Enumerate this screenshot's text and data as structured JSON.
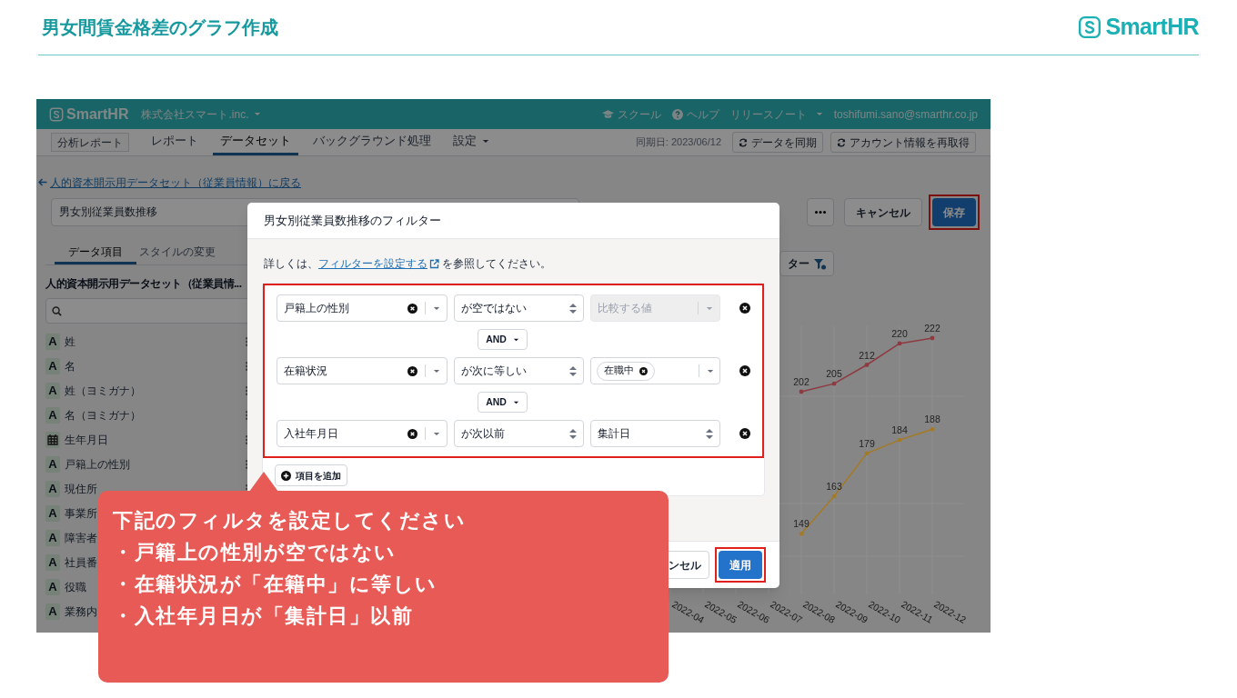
{
  "slide": {
    "title": "男女間賃金格差のグラフ作成",
    "logo": "SmartHR"
  },
  "app": {
    "header": {
      "logo": "SmartHR",
      "company": "株式会社スマート.inc.",
      "links": [
        {
          "kind": "school",
          "label": "スクール"
        },
        {
          "kind": "help",
          "label": "ヘルプ"
        },
        {
          "kind": "menu",
          "label": "リリースノート"
        }
      ],
      "user": "toshifumi.sano@smarthr.co.jp"
    },
    "nav": {
      "items": [
        {
          "label": "分析レポート",
          "kind": "button",
          "selected": false
        },
        {
          "label": "レポート",
          "kind": "tab",
          "selected": false
        },
        {
          "label": "データセット",
          "kind": "tab",
          "selected": true
        },
        {
          "label": "バックグラウンド処理",
          "kind": "tab",
          "selected": false
        },
        {
          "label": "設定",
          "kind": "menu",
          "selected": false
        }
      ],
      "sync_date": "同期日: 2023/06/12",
      "actions": [
        "データを同期",
        "アカウント情報を再取得"
      ]
    },
    "back_link": "人的資本開示用データセット（従業員情報）に戻る",
    "name_field": "男女別従業員数推移",
    "toolbar": [
      {
        "kind": "more",
        "highlighted": false
      },
      {
        "kind": "secondary",
        "label": "キャンセル",
        "highlighted": false
      },
      {
        "kind": "primary",
        "label": "保存",
        "highlighted": true
      }
    ],
    "tabs": [
      {
        "label": "データ項目",
        "selected": true
      },
      {
        "label": "スタイルの変更",
        "selected": false
      }
    ],
    "sidebar": {
      "heading": "人的資本開示用データセット（従業員情...",
      "items": [
        {
          "kind": "text",
          "badge": "A",
          "label": "姓"
        },
        {
          "kind": "text",
          "badge": "A",
          "label": "名"
        },
        {
          "kind": "text",
          "badge": "A",
          "label": "姓（ヨミガナ）"
        },
        {
          "kind": "text",
          "badge": "A",
          "label": "名（ヨミガナ）"
        },
        {
          "kind": "date",
          "label": "生年月日"
        },
        {
          "kind": "text",
          "badge": "A",
          "label": "戸籍上の性別"
        },
        {
          "kind": "text",
          "badge": "A",
          "label": "現住所"
        },
        {
          "kind": "text",
          "badge": "A",
          "label": "事業所"
        },
        {
          "kind": "text",
          "badge": "A",
          "label": "障害者"
        },
        {
          "kind": "text",
          "badge": "A",
          "label": "社員番"
        },
        {
          "kind": "text",
          "badge": "A",
          "label": "役職"
        },
        {
          "kind": "text",
          "badge": "A",
          "label": "業務内"
        }
      ]
    },
    "filter_button": "ター",
    "chart_data": {
      "type": "line",
      "categories": [
        "2022-04",
        "2022-05",
        "2022-06",
        "2022-07",
        "2022-08",
        "2022-09",
        "2022-10",
        "2022-11",
        "2022-12"
      ],
      "data_labels": true,
      "series": [
        {
          "color": "#8e3a40",
          "values": [
            null,
            null,
            null,
            null,
            202,
            205,
            212,
            220,
            222
          ]
        },
        {
          "color": "#a57a25",
          "values": [
            null,
            null,
            null,
            null,
            149,
            163,
            179,
            184,
            188
          ]
        }
      ]
    }
  },
  "modal": {
    "title": "男女別従業員数推移のフィルター",
    "help": {
      "before": "詳しくは、",
      "link": "フィルターを設定する",
      "after": "を参照してください。"
    },
    "conditions_highlighted": true,
    "conditions": [
      {
        "field": "戸籍上の性別",
        "operator": "が空ではない",
        "value": {
          "kind": "disabled",
          "placeholder": "比較する値"
        }
      },
      {
        "field": "在籍状況",
        "operator": "が次に等しい",
        "value": {
          "kind": "tags",
          "tags": [
            "在職中"
          ]
        }
      },
      {
        "field": "入社年月日",
        "operator": "が次以前",
        "value": {
          "kind": "select",
          "text": "集計日"
        }
      }
    ],
    "connectors": [
      "AND",
      "AND"
    ],
    "add_button": "項目を追加",
    "footer": [
      {
        "kind": "secondary",
        "label": "ンセル",
        "highlighted": false
      },
      {
        "kind": "primary",
        "label": "適用",
        "highlighted": true
      }
    ]
  },
  "callout": {
    "lines": [
      "下記のフィルタを設定してください",
      "・戸籍上の性別が空ではない",
      "・在籍状況が「在籍中」に等しい",
      "・入社年月日が「集計日」以前"
    ]
  }
}
